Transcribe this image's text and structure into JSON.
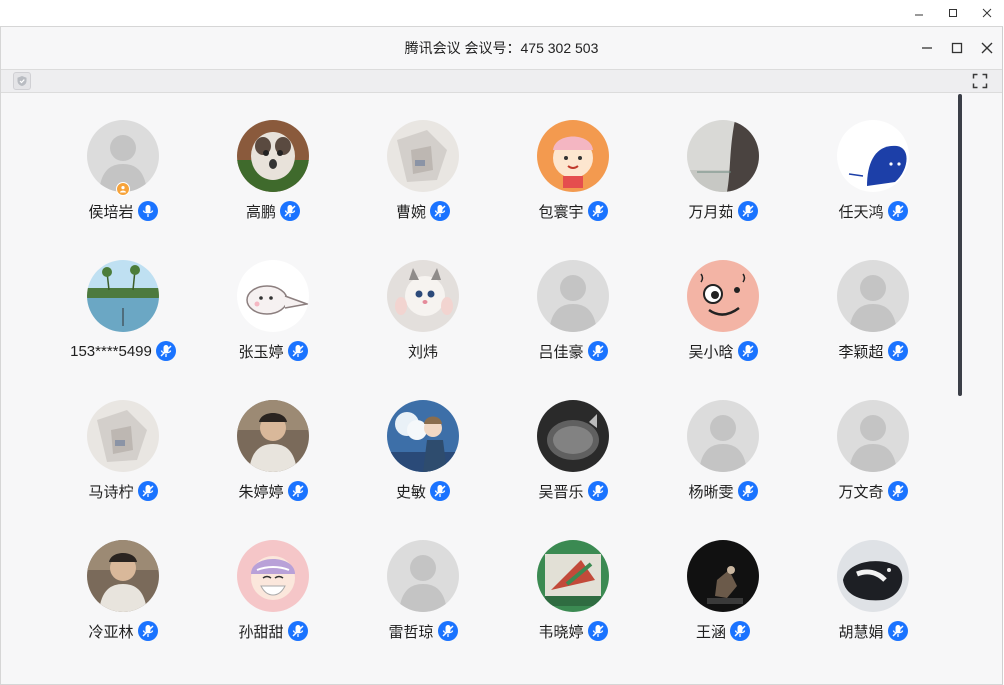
{
  "window": {
    "title": "腾讯会议 会议号：475 302 503"
  },
  "colors": {
    "accent": "#1a73ff",
    "host_badge": "#f7a33a",
    "background": "#f7f7f8"
  },
  "participants": [
    {
      "name": "侯培岩",
      "avatar": "default",
      "host": true,
      "mic": "on"
    },
    {
      "name": "高鹏",
      "avatar": "cat-photo",
      "host": false,
      "mic": "muted"
    },
    {
      "name": "曹婉",
      "avatar": "photo-light",
      "host": false,
      "mic": "muted"
    },
    {
      "name": "包寰宇",
      "avatar": "cartoon-orange",
      "host": false,
      "mic": "muted"
    },
    {
      "name": "万月茹",
      "avatar": "photo-grey",
      "host": false,
      "mic": "muted"
    },
    {
      "name": "任天鸿",
      "avatar": "blue-shape",
      "host": false,
      "mic": "muted"
    },
    {
      "name": "153****5499",
      "avatar": "beach-photo",
      "host": false,
      "mic": "muted"
    },
    {
      "name": "张玉婷",
      "avatar": "cartoon-white",
      "host": false,
      "mic": "muted"
    },
    {
      "name": "刘炜",
      "avatar": "kitten-photo",
      "host": false,
      "mic": "none"
    },
    {
      "name": "吕佳豪",
      "avatar": "default",
      "host": false,
      "mic": "muted"
    },
    {
      "name": "吴小晗",
      "avatar": "cartoon-pink",
      "host": false,
      "mic": "muted"
    },
    {
      "name": "李颖超",
      "avatar": "default",
      "host": false,
      "mic": "muted"
    },
    {
      "name": "马诗柠",
      "avatar": "photo-light",
      "host": false,
      "mic": "muted"
    },
    {
      "name": "朱婷婷",
      "avatar": "photo-person",
      "host": false,
      "mic": "muted"
    },
    {
      "name": "史敏",
      "avatar": "anime-sky",
      "host": false,
      "mic": "muted"
    },
    {
      "name": "吴晋乐",
      "avatar": "photo-dark",
      "host": false,
      "mic": "muted"
    },
    {
      "name": "杨晰雯",
      "avatar": "default",
      "host": false,
      "mic": "muted"
    },
    {
      "name": "万文奇",
      "avatar": "default",
      "host": false,
      "mic": "muted"
    },
    {
      "name": "冷亚林",
      "avatar": "photo-person",
      "host": false,
      "mic": "muted"
    },
    {
      "name": "孙甜甜",
      "avatar": "cartoon-mask",
      "host": false,
      "mic": "muted"
    },
    {
      "name": "雷哲琼",
      "avatar": "default",
      "host": false,
      "mic": "muted"
    },
    {
      "name": "韦晓婷",
      "avatar": "album-green",
      "host": false,
      "mic": "muted"
    },
    {
      "name": "王涵",
      "avatar": "photo-black",
      "host": false,
      "mic": "muted"
    },
    {
      "name": "胡慧娟",
      "avatar": "photo-cat-dark",
      "host": false,
      "mic": "muted"
    }
  ]
}
